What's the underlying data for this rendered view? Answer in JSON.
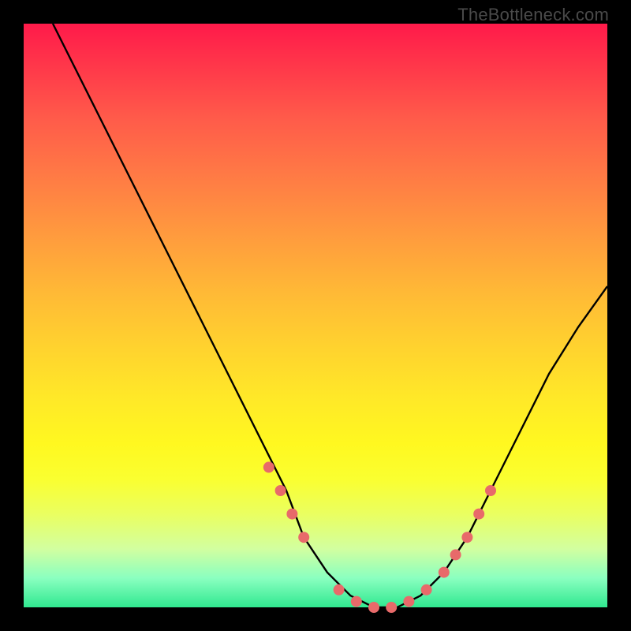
{
  "watermark": "TheBottleneck.com",
  "chart_data": {
    "type": "line",
    "title": "",
    "xlabel": "",
    "ylabel": "",
    "xlim": [
      0,
      100
    ],
    "ylim": [
      0,
      100
    ],
    "curve": {
      "name": "bottleneck-curve",
      "x": [
        5,
        10,
        15,
        20,
        25,
        30,
        35,
        40,
        45,
        48,
        52,
        56,
        60,
        64,
        68,
        72,
        76,
        80,
        85,
        90,
        95,
        100
      ],
      "y": [
        100,
        90,
        80,
        70,
        60,
        50,
        40,
        30,
        20,
        12,
        6,
        2,
        0,
        0,
        2,
        6,
        12,
        20,
        30,
        40,
        48,
        55
      ]
    },
    "markers": {
      "name": "highlight-points",
      "color": "#e86a6a",
      "x": [
        42,
        44,
        46,
        48,
        54,
        57,
        60,
        63,
        66,
        69,
        72,
        74,
        76,
        78,
        80
      ],
      "y": [
        24,
        20,
        16,
        12,
        3,
        1,
        0,
        0,
        1,
        3,
        6,
        9,
        12,
        16,
        20
      ]
    },
    "background_gradient": {
      "top": "#ff1a4a",
      "mid": "#ffe828",
      "bottom": "#30e890"
    }
  }
}
